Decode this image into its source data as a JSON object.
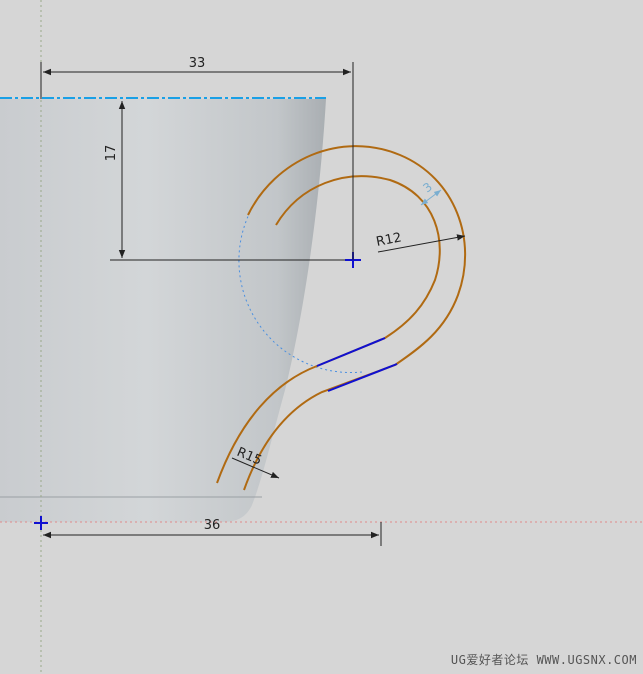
{
  "dimensions": {
    "top_width": "33",
    "height_to_center": "17",
    "radius_outer": "R12",
    "thickness": "3",
    "radius_lower": "R15",
    "bottom_width": "36"
  },
  "watermark": "UG爱好者论坛 WWW.UGSNX.COM",
  "colors": {
    "background": "#d6d6d6",
    "cup_fill": "#c4c8cb",
    "handle_curve": "#b06a12",
    "tangent_line": "#1010d0",
    "construction_circle": "#4a8fe0",
    "top_edge": "#1aa0e6",
    "dimension_line": "#222222",
    "thickness_dim": "#7aaed0",
    "datum_line": "#e08a8a"
  }
}
